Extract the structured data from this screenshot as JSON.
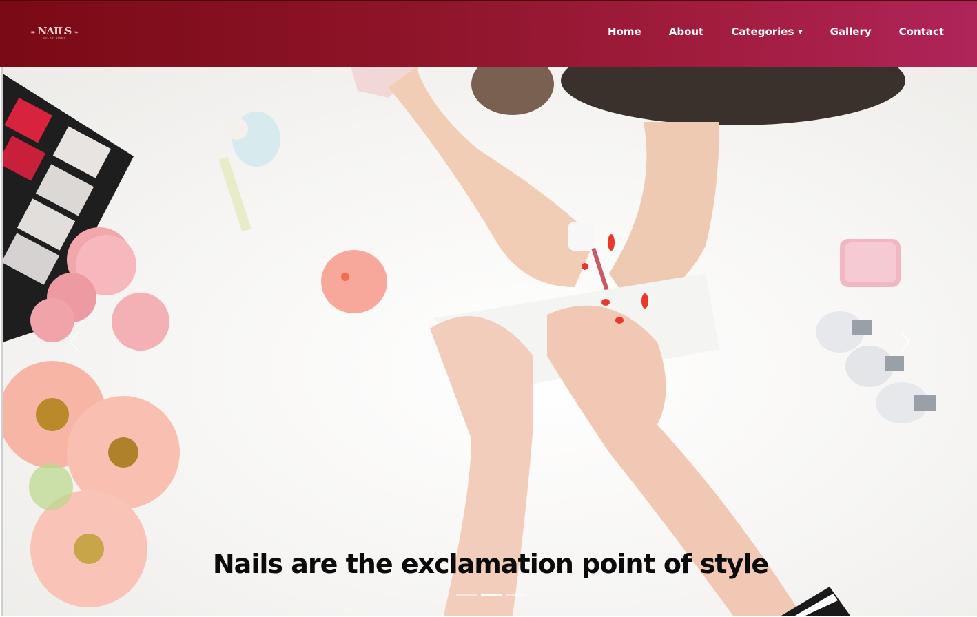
{
  "brand": {
    "logo_text": "NAILS",
    "logo_subtitle": "NAIL ART STUDIO"
  },
  "nav": {
    "items": [
      {
        "label": "Home"
      },
      {
        "label": "About"
      },
      {
        "label": "Categories",
        "dropdown": true
      },
      {
        "label": "Gallery"
      },
      {
        "label": "Contact"
      }
    ]
  },
  "hero": {
    "caption": "Nails are the exclamation point of style",
    "indicators": 3,
    "active_indicator": 2
  },
  "colors": {
    "nav_gradient_start": "#7a0a14",
    "nav_gradient_end": "#b0245a",
    "nav_text": "#ffffff",
    "caption_text": "#0b0b0b"
  },
  "icons": {
    "prev": "chevron-left-icon",
    "next": "chevron-right-icon",
    "dropdown": "caret-down-icon"
  }
}
